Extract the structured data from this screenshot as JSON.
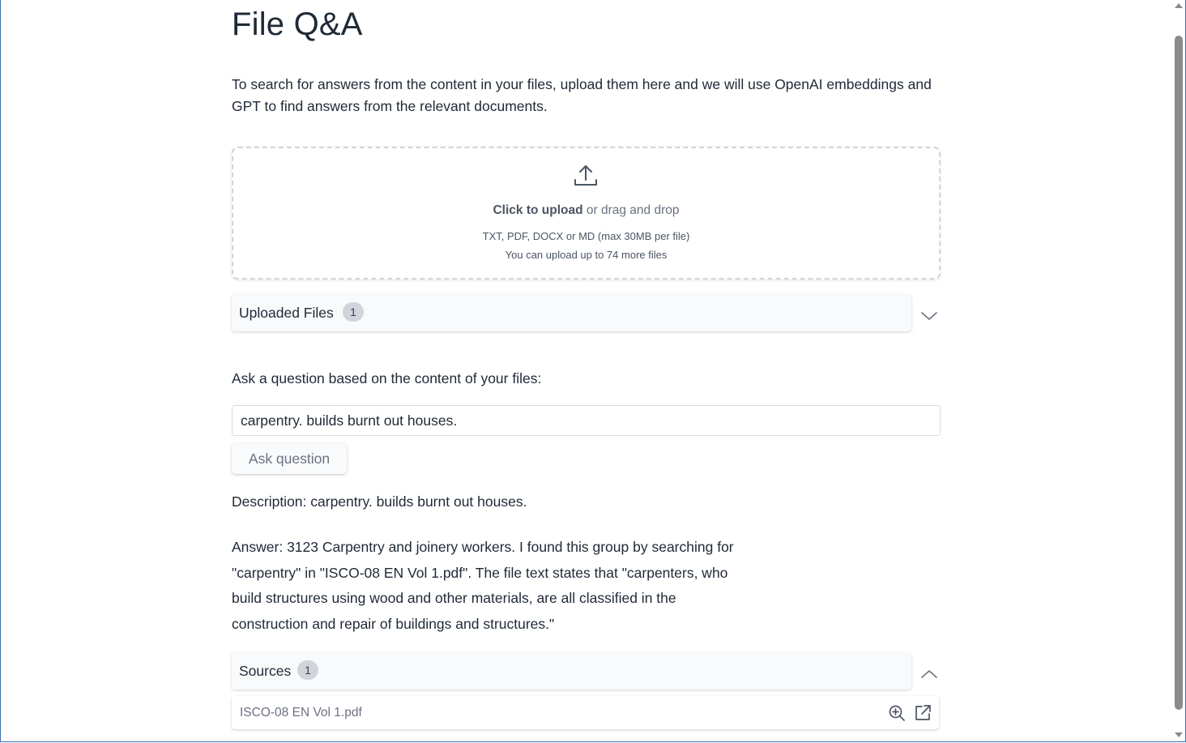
{
  "page": {
    "title": "File Q&A",
    "intro": "To search for answers from the content in your files, upload them here and we will use OpenAI embeddings and GPT to find answers from the relevant documents."
  },
  "upload": {
    "icon": "upload-icon",
    "click_label": "Click to upload",
    "drag_label": " or drag and drop",
    "formats_hint": "TXT, PDF, DOCX or MD (max 30MB per file)",
    "remaining_hint": "You can upload up to 74 more files"
  },
  "uploaded_files": {
    "label": "Uploaded Files",
    "count": "1",
    "icon": "chevron-down-icon"
  },
  "question": {
    "prompt": "Ask a question based on the content of your files:",
    "value": "carpentry. builds burnt out houses.",
    "button_label": "Ask question"
  },
  "result": {
    "description": "Description: carpentry. builds burnt out houses.",
    "answer": "Answer: 3123 Carpentry and joinery workers. I found this group by searching for \"carpentry\" in \"ISCO-08 EN Vol 1.pdf\". The file text states that \"carpenters, who build structures using wood and other materials, are all classified in the construction and repair of buildings and structures.\""
  },
  "sources": {
    "label": "Sources",
    "count": "1",
    "icon": "chevron-up-icon",
    "items": [
      {
        "name": "ISCO-08 EN Vol 1.pdf",
        "icons": [
          "zoom-in-icon",
          "external-link-icon"
        ]
      }
    ]
  },
  "colors": {
    "text": "#1f2937",
    "muted": "#6b7280",
    "badge": "#d1d5db",
    "border": "#cfd4dc",
    "window_border": "#3b6fb6"
  }
}
